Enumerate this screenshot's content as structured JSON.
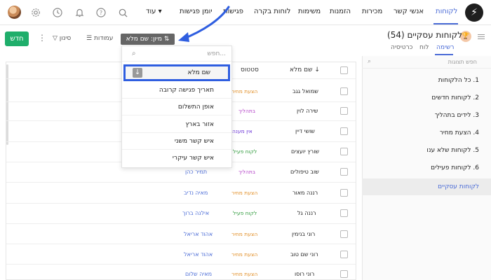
{
  "topbar": {
    "logo": "⚡",
    "nav": [
      "לקוחות",
      "אנשי קשר",
      "מכירות",
      "הזמנות",
      "משימות",
      "לוחות בקרה",
      "פגישות",
      "יומן פגישות",
      "עוד"
    ],
    "icons": [
      "search-icon",
      "help-icon",
      "bell-icon",
      "clock-icon",
      "gear-icon",
      "avatar"
    ]
  },
  "header": {
    "title": "לקוחות עסקיים (54)",
    "view_tabs": [
      "רשימה",
      "לוח",
      "כרטיסיה"
    ],
    "new_button": "חדש",
    "filter_label": "סינון",
    "columns_label": "עמודות",
    "sort_label": "מיון: שם מלא"
  },
  "sidebar": {
    "search_placeholder": "חפש תצוגות",
    "items": [
      "1. כל הלקוחות",
      "2. לקוחות חדשים",
      "3. לידים בתהליך",
      "4. הצעת מחיר",
      "5. לקוחות שלא ענו",
      "6. לקוחות פעילים",
      "לקוחות עסקיים"
    ]
  },
  "table": {
    "headers": {
      "name": "שם מלא ↓",
      "status": "סטטוס"
    },
    "rows": [
      {
        "name": "שמואל גגב",
        "status": "הצעת מחיר",
        "contact": ""
      },
      {
        "name": "שירה לוין",
        "status": "בתהליך",
        "contact": ""
      },
      {
        "name": "שושי דיין",
        "status": "אין מענה",
        "contact": ""
      },
      {
        "name": "שורץ יועצים",
        "status": "לקוח פעיל",
        "contact": ""
      },
      {
        "name": "שוב טיפולים",
        "status": "בתהליך",
        "contact": "תמיר כהן"
      },
      {
        "name": "רננה מאור",
        "status": "הצעת מחיר",
        "contact": "מאיה נדיב"
      },
      {
        "name": "רננה גל",
        "status": "לקוח פעיל",
        "contact": "אילנה ברוך"
      },
      {
        "name": "רוני בנימין",
        "status": "הצעת מחיר",
        "contact": "אהוד אריאל"
      },
      {
        "name": "רוני שם טוב",
        "status": "הצעת מחיר",
        "contact": "אהוד אריאל"
      },
      {
        "name": "רוני רוסו",
        "status": "הצעת מחיר",
        "contact": "מאיה שלום"
      }
    ]
  },
  "dropdown": {
    "search_placeholder": "חפש...",
    "items": [
      "שם מלא",
      "תאריך פגישה קרובה",
      "אופן התשלום",
      "אזור בארץ",
      "איש קשר משני",
      "איש קשר עיקרי"
    ]
  },
  "colors": {
    "accent": "#4a6bd6",
    "new_button": "#1fae6b",
    "status_quote": "#e08a1e",
    "status_progress": "#b23ec7",
    "status_noanswer": "#6a32d6",
    "status_active": "#2f9a3c",
    "highlight": "#2f5ee0"
  }
}
